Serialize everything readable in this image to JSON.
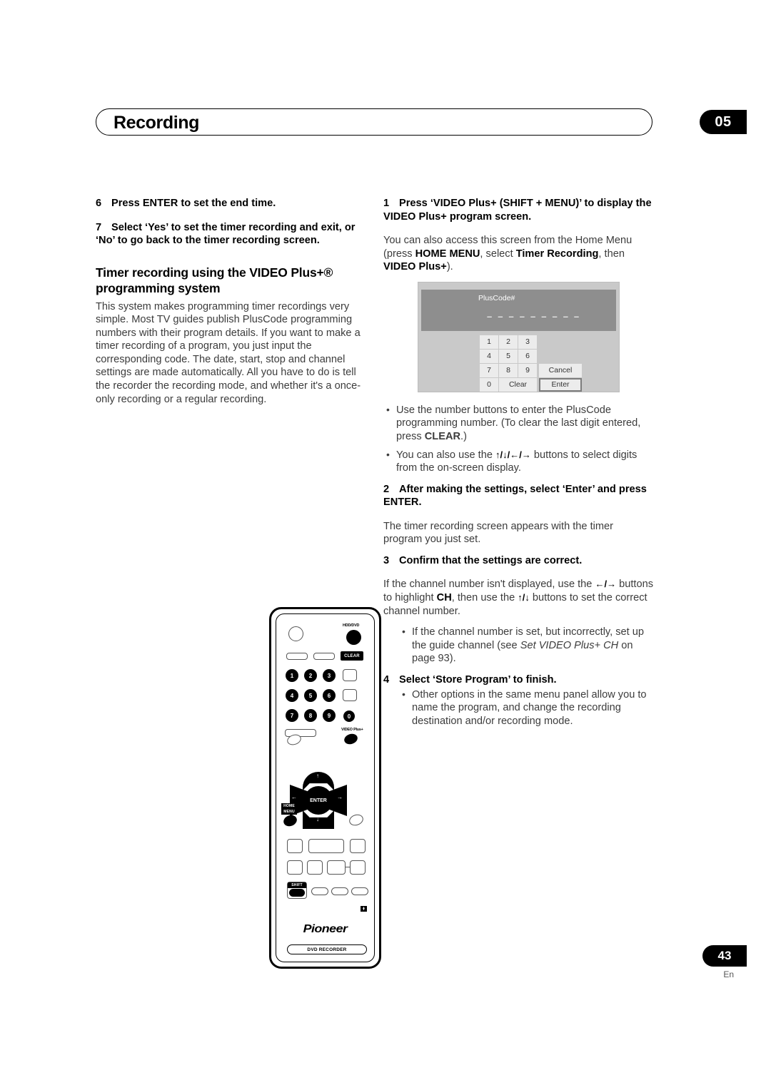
{
  "header": {
    "title": "Recording",
    "chapter": "05"
  },
  "left_column": {
    "step6": {
      "num": "6",
      "text": "Press ENTER to set the end time."
    },
    "step7": {
      "num": "7",
      "text": "Select ‘Yes’ to set the timer recording and exit, or ‘No’ to go back to the timer recording screen."
    },
    "section_heading": "Timer recording using the VIDEO Plus+® programming system",
    "section_body": "This system makes programming timer recordings very simple. Most TV guides publish PlusCode programming numbers with their program details. If you want to make a timer recording of a program, you just input the corresponding code. The date, start, stop and channel settings are made automatically. All you have to do is tell the recorder the recording mode, and whether it's a once-only recording or a regular recording."
  },
  "remote": {
    "hdd_dvd_label": "HDD/DVD",
    "clear_label": "CLEAR",
    "video_plus_label": "VIDEO Plus+",
    "enter_label": "ENTER",
    "home_menu_label_1": "HOME",
    "home_menu_label_2": "MENU",
    "shift_label": "SHIFT",
    "brand": "Pioneer",
    "model_label": "DVD RECORDER",
    "tiny_badge": "⧫",
    "number_keys": [
      "1",
      "2",
      "3",
      "4",
      "5",
      "6",
      "7",
      "8",
      "9",
      "0"
    ],
    "dpad_arrows": {
      "up": "↑",
      "down": "↓",
      "left": "←",
      "right": "→"
    }
  },
  "right_column": {
    "step1": {
      "num": "1",
      "heading": "Press ‘VIDEO Plus+ (SHIFT + MENU)’ to display the VIDEO Plus+ program screen.",
      "body_1": "You can also access this screen from the Home Menu (press ",
      "body_b1": "HOME MENU",
      "body_2": ", select ",
      "body_b2": "Timer Recording",
      "body_3": ", then ",
      "body_b3": "VIDEO Plus+",
      "body_4": ")."
    },
    "bullets_after_graphic": [
      {
        "text_1": "Use the number buttons to enter the PlusCode programming number. (To clear the last digit entered, press ",
        "bold": "CLEAR",
        "text_2": ".)"
      },
      {
        "text_1": "You can also use the ",
        "arrows": "↑/↓/←/→",
        "text_2": " buttons to select digits from the on-screen display."
      }
    ],
    "step2": {
      "num": "2",
      "heading": "After making the settings, select ‘Enter’ and press ENTER.",
      "body": "The timer recording screen appears with the timer program you just set."
    },
    "step3": {
      "num": "3",
      "heading": "Confirm that the settings are correct.",
      "body_1": "If the channel number isn't displayed, use the ",
      "arrows_1": "←/→",
      "body_2": " buttons to highlight ",
      "bold_1": "CH",
      "body_3": ", then use the ",
      "arrows_2": "↑/↓",
      "body_4": " buttons to set the correct channel number.",
      "bullet_1": "If the channel number is set, but incorrectly, set up the guide channel (see ",
      "bullet_1_italic": "Set VIDEO Plus+ CH",
      "bullet_1_tail": " on page 93)."
    },
    "step4": {
      "num": "4",
      "heading": "Select ‘Store Program’ to finish.",
      "bullet": "Other options in the same menu panel allow you to name the program, and change the recording destination and/or recording mode."
    }
  },
  "pluscode_screen": {
    "title": "PlusCode#",
    "dashes": "– – – – – – – – –",
    "keys_row1": [
      "1",
      "2",
      "3"
    ],
    "keys_row2": [
      "4",
      "5",
      "6"
    ],
    "keys_row3": [
      "7",
      "8",
      "9"
    ],
    "cancel_label": "Cancel",
    "zero_label": "0",
    "clear_label": "Clear",
    "enter_label": "Enter"
  },
  "footer": {
    "page_number": "43",
    "language": "En"
  },
  "colors": {
    "text_body": "#3c3c3c",
    "osd_background": "#c9c9c9",
    "osd_header": "#8e8e8e",
    "osd_key": "#ececec",
    "black": "#000000"
  }
}
